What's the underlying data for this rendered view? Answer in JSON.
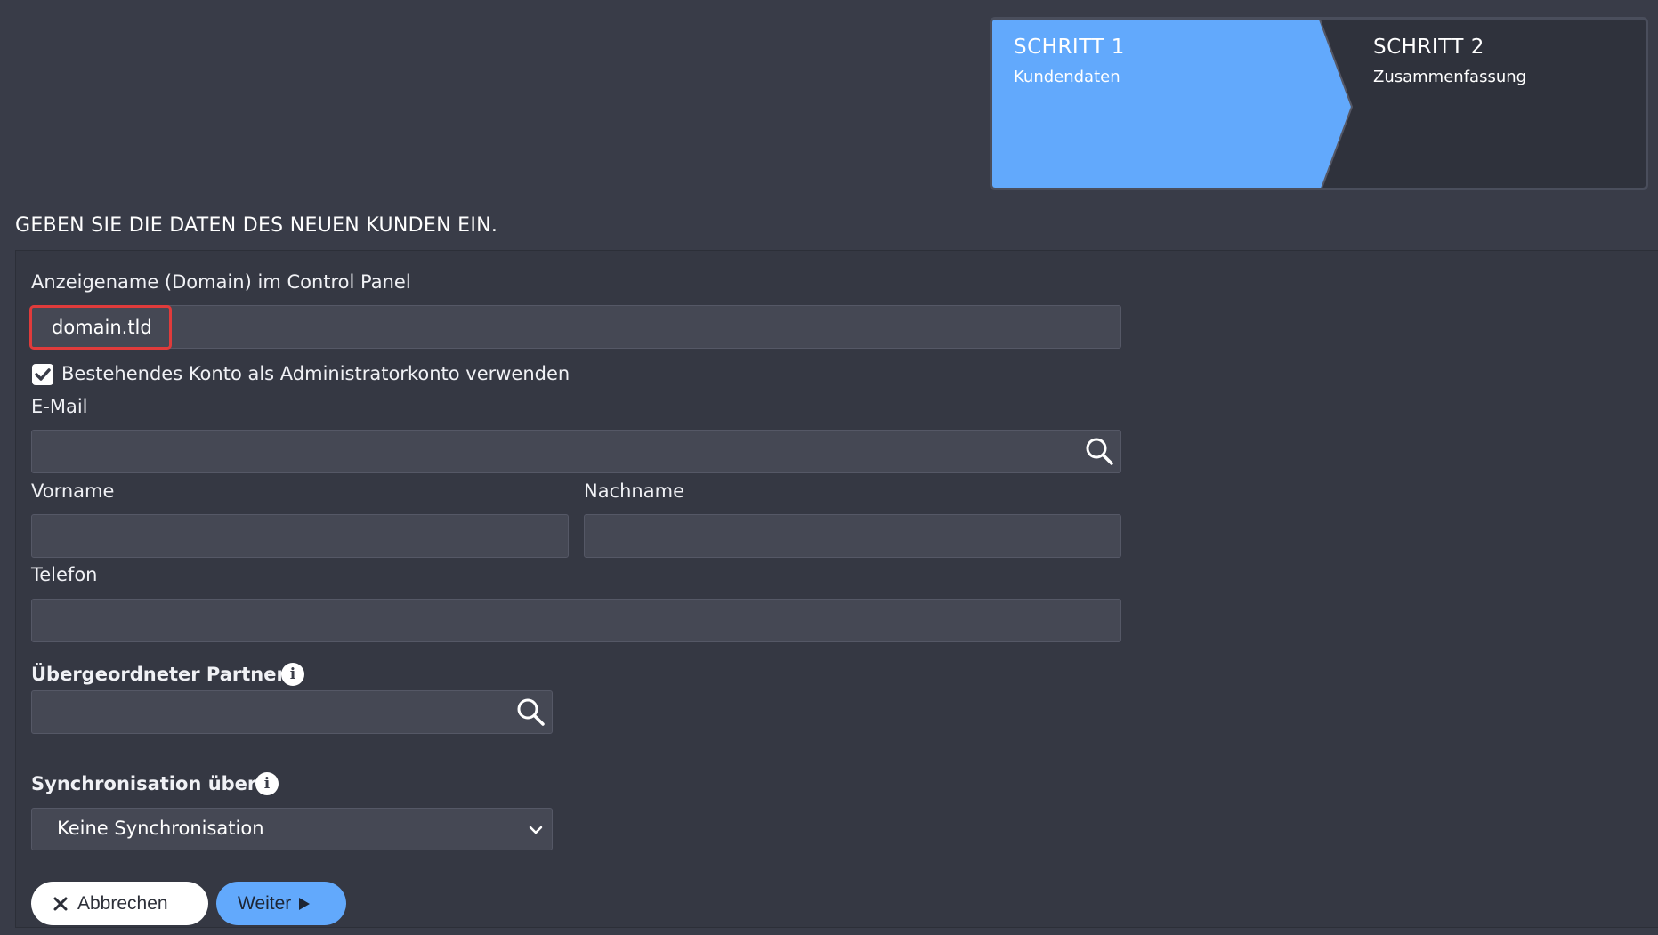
{
  "wizard": {
    "step1": {
      "title": "SCHRITT 1",
      "subtitle": "Kundendaten",
      "active": true
    },
    "step2": {
      "title": "SCHRITT 2",
      "subtitle": "Zusammenfassung",
      "active": false
    }
  },
  "heading": "GEBEN SIE DIE DATEN DES NEUEN KUNDEN EIN.",
  "form": {
    "display_name_label": "Anzeigename (Domain) im Control Panel",
    "display_name_value": "domain.tld",
    "use_existing_label": "Bestehendes Konto als Administratorkonto verwenden",
    "use_existing_checked": true,
    "email_label": "E-Mail",
    "email_value": "",
    "firstname_label": "Vorname",
    "firstname_value": "",
    "lastname_label": "Nachname",
    "lastname_value": "",
    "phone_label": "Telefon",
    "phone_value": "",
    "parent_partner_label": "Übergeordneter Partner",
    "parent_partner_value": "",
    "sync_label": "Synchronisation über",
    "sync_value": "Keine Synchronisation"
  },
  "buttons": {
    "cancel": "Abbrechen",
    "next": "Weiter"
  },
  "colors": {
    "background": "#393c48",
    "panel": "#353843",
    "accent": "#62a9fc",
    "highlight": "#e03b3b"
  },
  "icons": [
    "close-icon",
    "play-icon",
    "search-icon",
    "info-icon",
    "chevron-down-icon",
    "checkmark-icon"
  ]
}
